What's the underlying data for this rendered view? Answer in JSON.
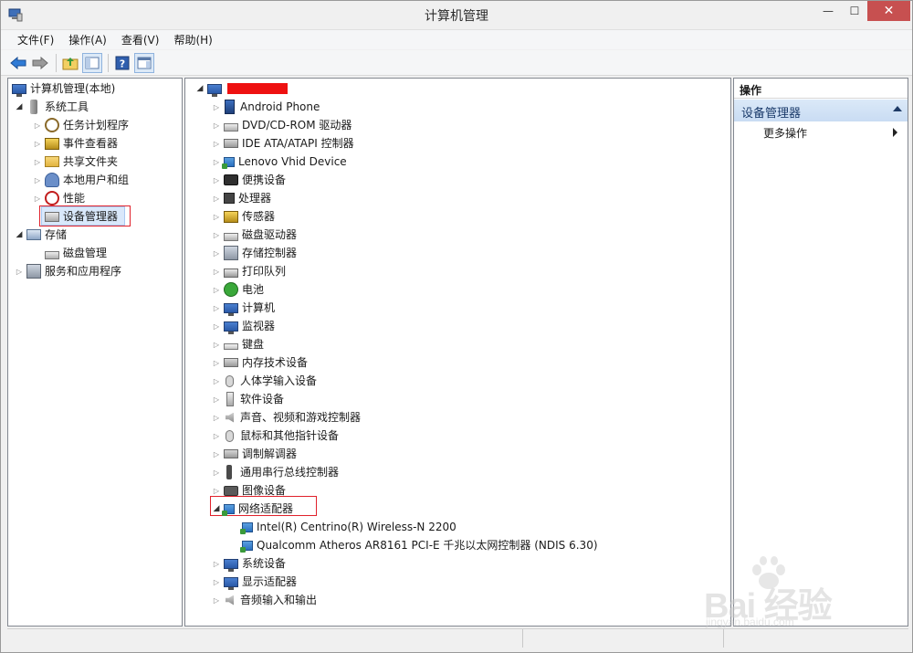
{
  "window": {
    "title": "计算机管理",
    "minimize": "—",
    "maximize": "☐",
    "close": "✕"
  },
  "menu": [
    "文件(F)",
    "操作(A)",
    "查看(V)",
    "帮助(H)"
  ],
  "toolbar_icons": [
    "back-arrow-icon",
    "forward-arrow-icon",
    "up-folder-icon",
    "show-hide-tree-icon",
    "help-icon",
    "properties-icon"
  ],
  "left_tree": {
    "root": "计算机管理(本地)",
    "system_tools": "系统工具",
    "task_scheduler": "任务计划程序",
    "event_viewer": "事件查看器",
    "shared_folders": "共享文件夹",
    "local_users": "本地用户和组",
    "performance": "性能",
    "device_manager": "设备管理器",
    "storage": "存储",
    "disk_management": "磁盘管理",
    "services_apps": "服务和应用程序"
  },
  "device_tree": {
    "categories": [
      "Android Phone",
      "DVD/CD-ROM 驱动器",
      "IDE ATA/ATAPI 控制器",
      "Lenovo Vhid Device",
      "便携设备",
      "处理器",
      "传感器",
      "磁盘驱动器",
      "存储控制器",
      "打印队列",
      "电池",
      "计算机",
      "监视器",
      "键盘",
      "内存技术设备",
      "人体学输入设备",
      "软件设备",
      "声音、视频和游戏控制器",
      "鼠标和其他指针设备",
      "调制解调器",
      "通用串行总线控制器",
      "图像设备",
      "网络适配器"
    ],
    "network_children": [
      "Intel(R) Centrino(R) Wireless-N 2200",
      "Qualcomm Atheros AR8161 PCI-E 千兆以太网控制器 (NDIS 6.30)"
    ],
    "after": [
      "系统设备",
      "显示适配器",
      "音频输入和输出"
    ]
  },
  "actions": {
    "header": "操作",
    "section": "设备管理器",
    "more": "更多操作"
  },
  "watermark": {
    "brand": "Bai 经验",
    "url": "jingyan.baidu.com"
  }
}
